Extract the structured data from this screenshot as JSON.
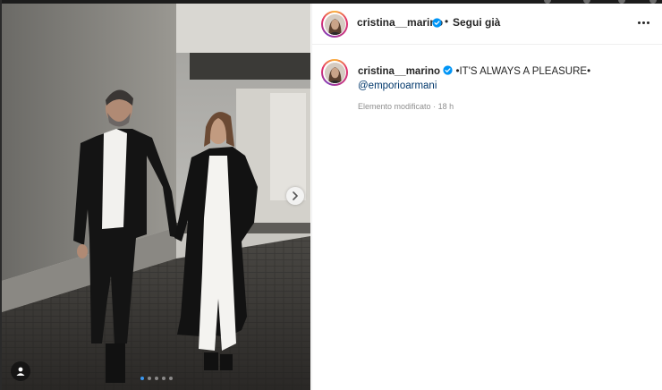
{
  "post": {
    "author": {
      "username": "cristina__marino",
      "verified": true
    },
    "follow_separator": "•",
    "follow_label": "Segui già",
    "more_options_icon": "more-horizontal-icon",
    "caption": {
      "username": "cristina__marino",
      "text": "•IT'S ALWAYS A PLEASURE•",
      "mention": "@emporioarmani"
    },
    "edited_label": "Elemento modificato",
    "meta_separator": "·",
    "timestamp": "18 h"
  },
  "carousel": {
    "slide_count": 5,
    "active_index": 0,
    "next_icon": "chevron-right-icon",
    "tag_icon": "user-tag-icon"
  },
  "colors": {
    "verified": "#0095f6",
    "mention": "#00376b",
    "meta": "#8e8e8e",
    "carousel_active_dot": "#3a97f0"
  }
}
